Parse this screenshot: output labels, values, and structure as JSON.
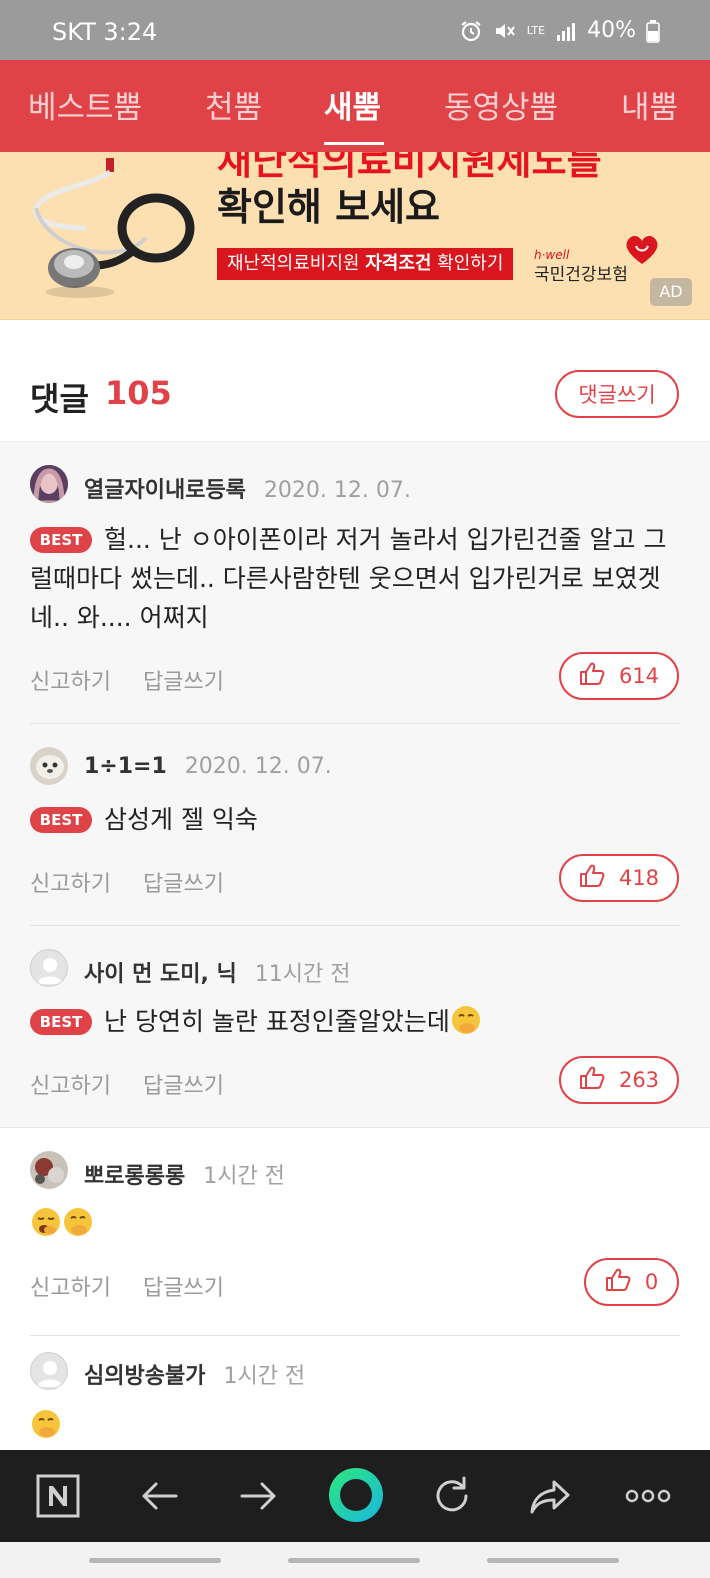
{
  "status_bar": {
    "carrier_time": "SKT 3:24",
    "battery": "40%",
    "network": "LTE"
  },
  "tabs": [
    {
      "label": "베스트뿜",
      "active": false
    },
    {
      "label": "천뿜",
      "active": false
    },
    {
      "label": "새뿜",
      "active": true
    },
    {
      "label": "동영상뿜",
      "active": false
    },
    {
      "label": "내뿜",
      "active": false
    }
  ],
  "ad": {
    "headline_cut": "재난적의료비지원제도를",
    "headline": "확인해 보세요",
    "cta_prefix": "재난적의료비지원 ",
    "cta_bold": "자격조건",
    "cta_suffix": " 확인하기",
    "brand_en": "h·well",
    "brand": "국민건강보험",
    "badge": "AD"
  },
  "comments_header": {
    "title": "댓글",
    "count": "105",
    "write_label": "댓글쓰기"
  },
  "comments": [
    {
      "nick": "열글자이내로등록",
      "date": "2020. 12. 07.",
      "best": "BEST",
      "text": "헐... 난 ㅇ아이폰이라 저거 놀라서 입가린건줄 알고 그럴때마다 썼는데.. 다른사람한텐 웃으면서 입가린거로 보였겟네.. 와.... 어쩌지",
      "report": "신고하기",
      "reply": "답글쓰기",
      "likes": "614"
    },
    {
      "nick": "1÷1=1",
      "date": "2020. 12. 07.",
      "best": "BEST",
      "text": "삼성게 젤 익숙",
      "report": "신고하기",
      "reply": "답글쓰기",
      "likes": "418"
    },
    {
      "nick": "사이 먼 도미, 닉",
      "date": "11시간 전",
      "best": "BEST",
      "text": "난 당연히 놀란 표정인줄알았는데",
      "report": "신고하기",
      "reply": "답글쓰기",
      "likes": "263"
    },
    {
      "nick": "뽀로롱롱롱",
      "date": "1시간 전",
      "text": "",
      "report": "신고하기",
      "reply": "답글쓰기",
      "likes": "0"
    },
    {
      "nick": "심의방송불가",
      "date": "1시간 전",
      "text": ""
    }
  ],
  "colors": {
    "accent": "#e04347",
    "status_bar": "#9b9b9b",
    "ad_bg": "#fde0b1",
    "nav_bg": "#1e1e1e"
  },
  "bottom_nav": [
    "naver-n-icon",
    "back-arrow-icon",
    "forward-arrow-icon",
    "green-dot-icon",
    "reload-icon",
    "share-icon",
    "more-icon"
  ]
}
